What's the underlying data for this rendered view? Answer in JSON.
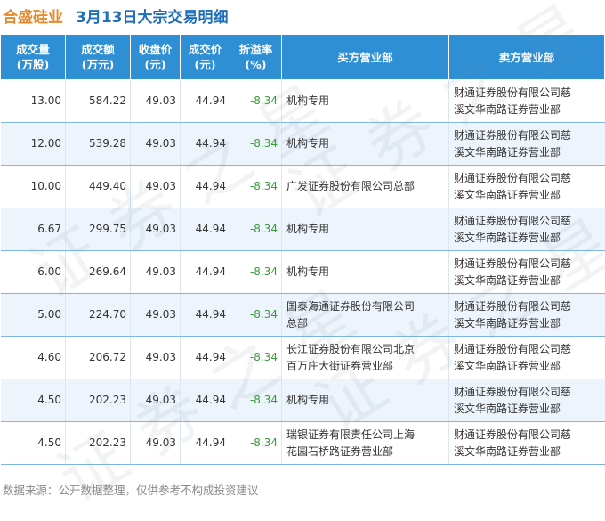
{
  "header": {
    "company": "合盛硅业",
    "title": "3月13日大宗交易明细"
  },
  "table": {
    "columns": [
      [
        "成交量",
        "(万股)"
      ],
      [
        "成交额",
        "(万元)"
      ],
      [
        "收盘价",
        "(元)"
      ],
      [
        "成交价",
        "(元)"
      ],
      [
        "折溢率",
        "(%)"
      ],
      [
        "买方营业部",
        ""
      ],
      [
        "卖方营业部",
        ""
      ]
    ],
    "rows": [
      {
        "volume": "13.00",
        "amount": "584.22",
        "close": "49.03",
        "price": "44.94",
        "premium": "-8.34",
        "buyer": [
          "机构专用",
          ""
        ],
        "seller": [
          "财通证券股份有限公司慈",
          "溪文华南路证券营业部"
        ]
      },
      {
        "volume": "12.00",
        "amount": "539.28",
        "close": "49.03",
        "price": "44.94",
        "premium": "-8.34",
        "buyer": [
          "机构专用",
          ""
        ],
        "seller": [
          "财通证券股份有限公司慈",
          "溪文华南路证券营业部"
        ]
      },
      {
        "volume": "10.00",
        "amount": "449.40",
        "close": "49.03",
        "price": "44.94",
        "premium": "-8.34",
        "buyer": [
          "广发证券股份有限公司总部",
          ""
        ],
        "seller": [
          "财通证券股份有限公司慈",
          "溪文华南路证券营业部"
        ]
      },
      {
        "volume": "6.67",
        "amount": "299.75",
        "close": "49.03",
        "price": "44.94",
        "premium": "-8.34",
        "buyer": [
          "机构专用",
          ""
        ],
        "seller": [
          "财通证券股份有限公司慈",
          "溪文华南路证券营业部"
        ]
      },
      {
        "volume": "6.00",
        "amount": "269.64",
        "close": "49.03",
        "price": "44.94",
        "premium": "-8.34",
        "buyer": [
          "机构专用",
          ""
        ],
        "seller": [
          "财通证券股份有限公司慈",
          "溪文华南路证券营业部"
        ]
      },
      {
        "volume": "5.00",
        "amount": "224.70",
        "close": "49.03",
        "price": "44.94",
        "premium": "-8.34",
        "buyer": [
          "国泰海通证券股份有限公司",
          "总部"
        ],
        "seller": [
          "财通证券股份有限公司慈",
          "溪文华南路证券营业部"
        ]
      },
      {
        "volume": "4.60",
        "amount": "206.72",
        "close": "49.03",
        "price": "44.94",
        "premium": "-8.34",
        "buyer": [
          "长江证券股份有限公司北京",
          "百万庄大街证券营业部"
        ],
        "seller": [
          "财通证券股份有限公司慈",
          "溪文华南路证券营业部"
        ]
      },
      {
        "volume": "4.50",
        "amount": "202.23",
        "close": "49.03",
        "price": "44.94",
        "premium": "-8.34",
        "buyer": [
          "机构专用",
          ""
        ],
        "seller": [
          "财通证券股份有限公司慈",
          "溪文华南路证券营业部"
        ]
      },
      {
        "volume": "4.50",
        "amount": "202.23",
        "close": "49.03",
        "price": "44.94",
        "premium": "-8.34",
        "buyer": [
          "瑞银证券有限责任公司上海",
          "花园石桥路证券营业部"
        ],
        "seller": [
          "财通证券股份有限公司慈",
          "溪文华南路证券营业部"
        ]
      }
    ]
  },
  "footer": {
    "source": "数据来源：公开数据整理，仅供参考不构成投资建议"
  },
  "watermark": {
    "text": "证券之星"
  },
  "colors": {
    "header_bg": "#2e8fd5",
    "company": "#e88a2b",
    "title": "#1f6fb8",
    "premium": "#3a9a3a"
  }
}
